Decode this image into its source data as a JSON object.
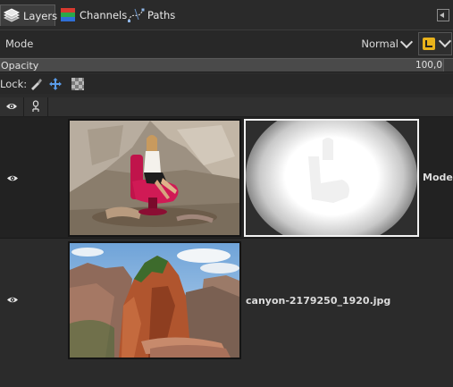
{
  "tabs": [
    {
      "label": "Layers",
      "icon": "layers-icon",
      "active": true
    },
    {
      "label": "Channels",
      "icon": "channels-icon",
      "active": false
    },
    {
      "label": "Paths",
      "icon": "paths-icon",
      "active": false
    }
  ],
  "mode": {
    "label": "Mode",
    "value": "Normal"
  },
  "opacity": {
    "label": "Opacity",
    "value": "100,0"
  },
  "lock": {
    "label": "Lock:",
    "icons": [
      "lock-pixels-icon",
      "lock-position-icon",
      "lock-alpha-icon"
    ]
  },
  "header_icons": [
    "visibility-header-icon",
    "chain-header-icon"
  ],
  "layers": [
    {
      "name": "Model",
      "visible": true,
      "has_mask": true
    },
    {
      "name": "canyon-2179250_1920.jpg",
      "visible": true,
      "has_mask": false
    }
  ],
  "colors": {
    "accent": "#e8b21b",
    "panel": "#2b2b2b",
    "selected_row": "#222222"
  }
}
